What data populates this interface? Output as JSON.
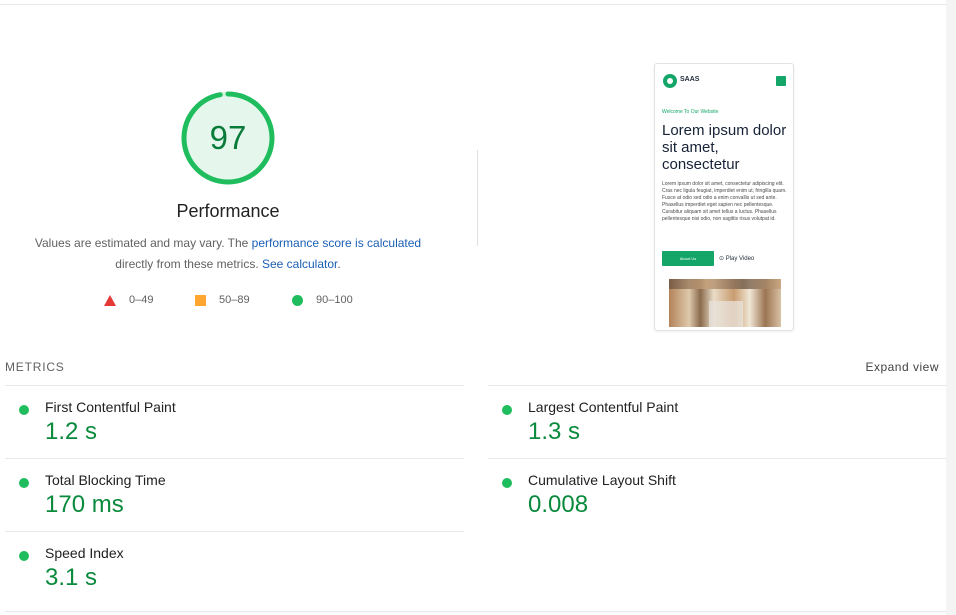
{
  "performance": {
    "score": "97",
    "score_fraction": 0.97,
    "title": "Performance",
    "desc_prefix": "Values are estimated and may vary. The ",
    "desc_link1": "performance score is calculated",
    "desc_middle": "directly from these metrics. ",
    "desc_link2": "See calculator",
    "desc_suffix": ".",
    "legend": {
      "fail_range": "0–49",
      "average_range": "50–89",
      "pass_range": "90–100"
    }
  },
  "screenshot": {
    "brand": "SAAS",
    "welcome": "Welcome To Our Website",
    "heading": "Lorem ipsum dolor sit amet, consectetur",
    "body": "Lorem ipsum dolor sit amet, consectetur adipiscing elit. Cras nec ligula feugiat, imperdiet enim ut, fringilla quam. Fusce at odio sed odio a enim convallis ut sed ante. Phasellus imperdiet eget sapien nec pellentesque. Curabitur aliquam sit amet tellus a luctus. Phasellus pellentesque nisi odio, non sagittis risus volutpat id.",
    "button": "About Us",
    "play": "⊙ Play Video"
  },
  "metrics": {
    "heading": "METRICS",
    "expand": "Expand view",
    "fcp": {
      "label": "First Contentful Paint",
      "value": "1.2 s"
    },
    "lcp": {
      "label": "Largest Contentful Paint",
      "value": "1.3 s"
    },
    "tbt": {
      "label": "Total Blocking Time",
      "value": "170 ms"
    },
    "cls": {
      "label": "Cumulative Layout Shift",
      "value": "0.008"
    },
    "si": {
      "label": "Speed Index",
      "value": "3.1 s"
    }
  },
  "colors": {
    "pass": "#1fbd5e",
    "average": "#ffa630",
    "fail": "#e53935",
    "score_text": "#0a7c3a",
    "link": "#1a5fb4",
    "brand_green": "#14a569"
  }
}
